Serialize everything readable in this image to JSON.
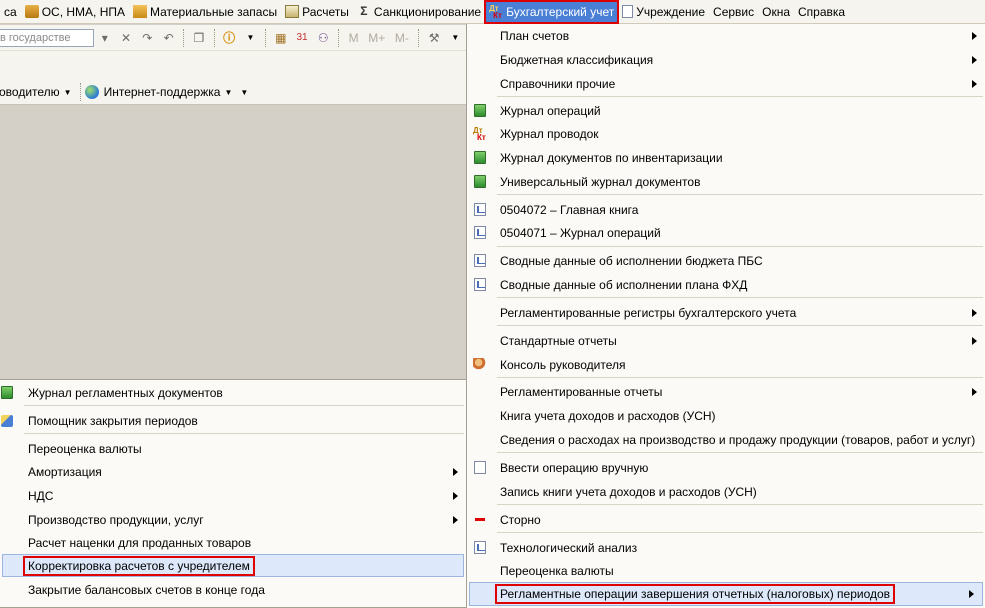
{
  "menubar": {
    "items": [
      {
        "label": "са"
      },
      {
        "label": "ОС, НМА, НПА"
      },
      {
        "label": "Материальные запасы"
      },
      {
        "label": "Расчеты"
      },
      {
        "label": "Санкционирование"
      },
      {
        "label": "Бухгалтерский учет"
      },
      {
        "label": "Учреждение"
      },
      {
        "label": "Сервис"
      },
      {
        "label": "Окна"
      },
      {
        "label": "Справка"
      }
    ]
  },
  "toolbar": {
    "search_value": "в государстве",
    "internet_support": "Интернет-поддержка",
    "director_label": "оводителю",
    "m_buttons": [
      "M",
      "M+",
      "M-"
    ]
  },
  "menu": {
    "items": [
      {
        "label": "План счетов"
      },
      {
        "label": "Бюджетная классификация"
      },
      {
        "label": "Справочники прочие"
      },
      {
        "label": "Журнал операций"
      },
      {
        "label": "Журнал проводок"
      },
      {
        "label": "Журнал документов по инвентаризации"
      },
      {
        "label": "Универсальный журнал документов"
      },
      {
        "label": "0504072  –  Главная книга"
      },
      {
        "label": "0504071  –  Журнал операций"
      },
      {
        "label": "Сводные данные об исполнении бюджета ПБС"
      },
      {
        "label": "Сводные данные об исполнении плана ФХД"
      },
      {
        "label": "Регламентированные регистры бухгалтерского учета"
      },
      {
        "label": "Стандартные отчеты"
      },
      {
        "label": "Консоль руководителя"
      },
      {
        "label": "Регламентированные отчеты"
      },
      {
        "label": "Книга учета доходов и расходов (УСН)"
      },
      {
        "label": "Сведения о расходах на производство и продажу продукции (товаров, работ и услуг)"
      },
      {
        "label": "Ввести операцию вручную"
      },
      {
        "label": "Запись книги учета доходов и расходов (УСН)"
      },
      {
        "label": "Сторно"
      },
      {
        "label": "Технологический анализ"
      },
      {
        "label": "Переоценка валюты"
      },
      {
        "label": "Регламентные операции завершения отчетных (налоговых) периодов"
      }
    ]
  },
  "submenu": {
    "items": [
      {
        "label": "Журнал регламентных документов"
      },
      {
        "label": "Помощник закрытия периодов"
      },
      {
        "label": "Переоценка валюты"
      },
      {
        "label": "Амортизация"
      },
      {
        "label": "НДС"
      },
      {
        "label": "Производство продукции, услуг"
      },
      {
        "label": "Расчет наценки для проданных товаров"
      },
      {
        "label": "Корректировка расчетов с учредителем"
      },
      {
        "label": "Закрытие балансовых счетов в конце года"
      }
    ]
  },
  "colors": {
    "highlight_outline": "#e00000",
    "active_menu": "#4a7fd6",
    "menu_bg": "#fbfaf7",
    "workspace": "#d4d0c8"
  }
}
